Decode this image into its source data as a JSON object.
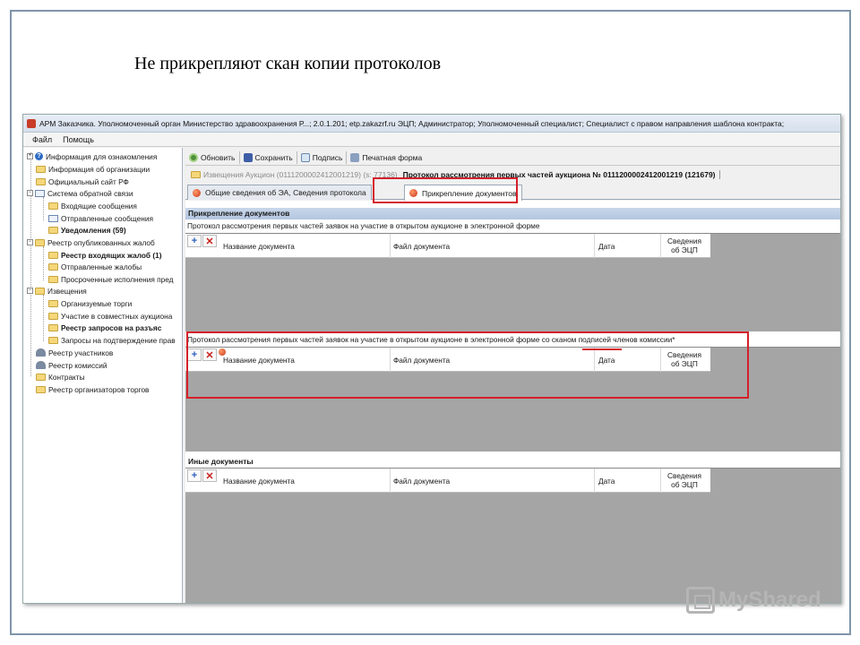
{
  "slide": {
    "title": "Не прикрепляют скан копии протоколов"
  },
  "window": {
    "title": "АРМ Заказчика. Уполномоченный орган Министерство здравоохранения Р...; 2.0.1.201; etp.zakazrf.ru   ЭЦП; Администратор; Уполномоченный специалист; Специалист с правом направления шаблона контракта;"
  },
  "menu": [
    "Файл",
    "Помощь"
  ],
  "sidebar": {
    "items": [
      {
        "label": "Информация для ознакомления",
        "icon": "info-icon"
      },
      {
        "label": "Информация об организации",
        "icon": "folder-icon"
      },
      {
        "label": "Официальный сайт РФ",
        "icon": "folder-icon"
      },
      {
        "label": "Система обратной связи",
        "icon": "mail-icon"
      },
      {
        "label": "Входящие сообщения",
        "icon": "folder-icon"
      },
      {
        "label": "Отправленные сообщения",
        "icon": "mail-icon"
      },
      {
        "label": "Уведомления (59)",
        "icon": "folder-icon"
      },
      {
        "label": "Реестр опубликованных жалоб",
        "icon": "folder-icon"
      },
      {
        "label": "Реестр входящих жалоб (1)",
        "icon": "folder-icon"
      },
      {
        "label": "Отправленные жалобы",
        "icon": "folder-icon"
      },
      {
        "label": "Просроченные исполнения пред",
        "icon": "folder-icon"
      },
      {
        "label": "Извещения",
        "icon": "folder-icon"
      },
      {
        "label": "Организуемые торги",
        "icon": "folder-icon"
      },
      {
        "label": "Участие в совместных аукциона",
        "icon": "folder-icon"
      },
      {
        "label": "Реестр запросов на разъяс",
        "icon": "folder-icon"
      },
      {
        "label": "Запросы на подтверждение прав",
        "icon": "folder-icon"
      },
      {
        "label": "Реестр участников",
        "icon": "people-icon"
      },
      {
        "label": "Реестр комиссий",
        "icon": "people-icon"
      },
      {
        "label": "Контракты",
        "icon": "folder-icon"
      },
      {
        "label": "Реестр организаторов торгов",
        "icon": "folder-icon"
      }
    ]
  },
  "toolbar": {
    "refresh": "Обновить",
    "save": "Сохранить",
    "sign": "Подпись",
    "print": "Печатная форма"
  },
  "breadcrumb": {
    "part1": "Извещения",
    "part2": "Аукцион (0111200002412001219) (s: 77136)",
    "current": "Протокол рассмотрения первых частей аукциона № 0111200002412001219 (121679)"
  },
  "tabs": {
    "general": "Общие сведения об ЭА, Сведения протокола",
    "attach": "Прикрепление документов"
  },
  "attach": {
    "header": "Прикрепление документов",
    "caption1": "Протокол рассмотрения первых частей заявок на участие в открытом аукционе в электронной форме",
    "caption2": "Протокол рассмотрения первых частей заявок на участие в открытом аукционе в электронной форме со сканом подписей членов комиссии*",
    "other_header": "Иные документы",
    "columns": {
      "name": "Название документа",
      "file": "Файл документа",
      "date": "Дата",
      "ecp1": "Сведения",
      "ecp2": "об ЭЦП"
    },
    "add": "+",
    "del": "✕"
  },
  "watermark": {
    "text": "MyShared"
  },
  "colors": {
    "highlight": "#d4202a",
    "section_header": "#c9d7ea"
  }
}
